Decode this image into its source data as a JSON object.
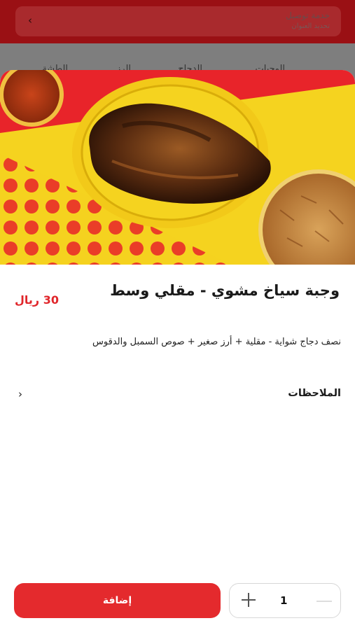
{
  "background": {
    "delivery_title": "خدمة توصيل",
    "delivery_subtitle": "تحديد العنوان",
    "nav_tabs": [
      "الوجبات",
      "الدجاج",
      "الرز",
      "الطشة"
    ]
  },
  "item": {
    "title": "وجبة سياخ مشوي - مقلي وسط",
    "price": "30 ريال",
    "description": "نصف دجاج شواية - مقلية + أرز صغير + صوص السمبل والدقوس"
  },
  "notes": {
    "label": "الملاحظات"
  },
  "footer": {
    "add_label": "إضافة",
    "quantity": "1"
  },
  "colors": {
    "accent": "#e42a2d",
    "price": "#e0262b",
    "hero_red": "#e8242a",
    "hero_yellow": "#f5d31f"
  }
}
